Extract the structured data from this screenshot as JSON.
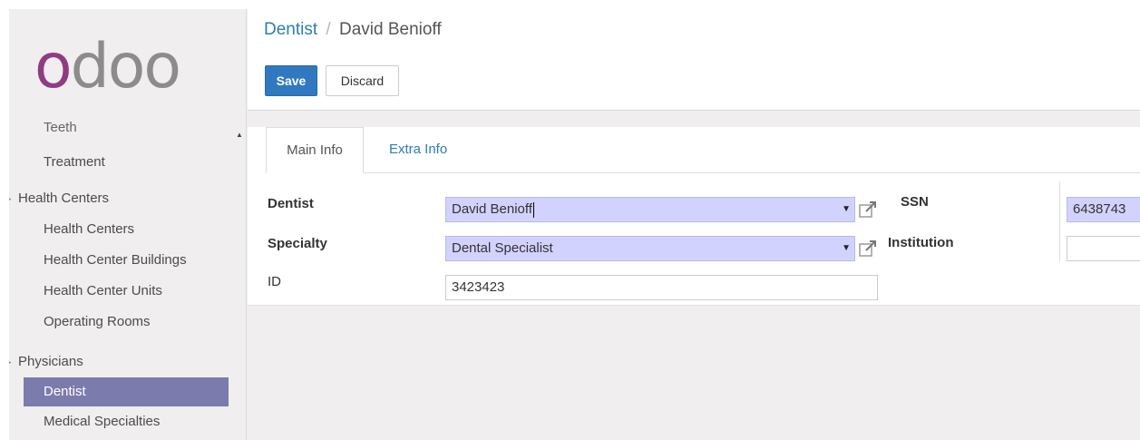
{
  "logo": {
    "first_letter": "o",
    "rest": "doo"
  },
  "sidebar": {
    "items": [
      {
        "label": "Teeth",
        "type": "sub",
        "cut": true
      },
      {
        "label": "Treatment",
        "type": "sub"
      },
      {
        "label": "Health Centers",
        "type": "section"
      },
      {
        "label": "Health Centers",
        "type": "sub"
      },
      {
        "label": "Health Center Buildings",
        "type": "sub"
      },
      {
        "label": "Health Center Units",
        "type": "sub"
      },
      {
        "label": "Operating Rooms",
        "type": "sub"
      },
      {
        "label": "Physicians",
        "type": "section"
      },
      {
        "label": "Dentist",
        "type": "sub",
        "active": true
      },
      {
        "label": "Medical Specialties",
        "type": "sub"
      }
    ]
  },
  "breadcrumb": {
    "parent": "Dentist",
    "separator": "/",
    "current": "David Benioff"
  },
  "toolbar": {
    "save_label": "Save",
    "discard_label": "Discard"
  },
  "tabs": [
    {
      "label": "Main Info"
    },
    {
      "label": "Extra Info"
    }
  ],
  "form": {
    "dentist": {
      "label": "Dentist",
      "value": "David Benioff"
    },
    "specialty": {
      "label": "Specialty",
      "value": "Dental Specialist"
    },
    "id": {
      "label": "ID",
      "value": "3423423"
    },
    "ssn": {
      "label": "SSN",
      "value": "6438743"
    },
    "institution": {
      "label": "Institution",
      "value": ""
    }
  },
  "colors": {
    "brand": "#8f3c82",
    "primary_button": "#3079c0",
    "active_menu": "#7c7bad",
    "required_field": "#d2d2ff",
    "link": "#2d7cb6"
  }
}
